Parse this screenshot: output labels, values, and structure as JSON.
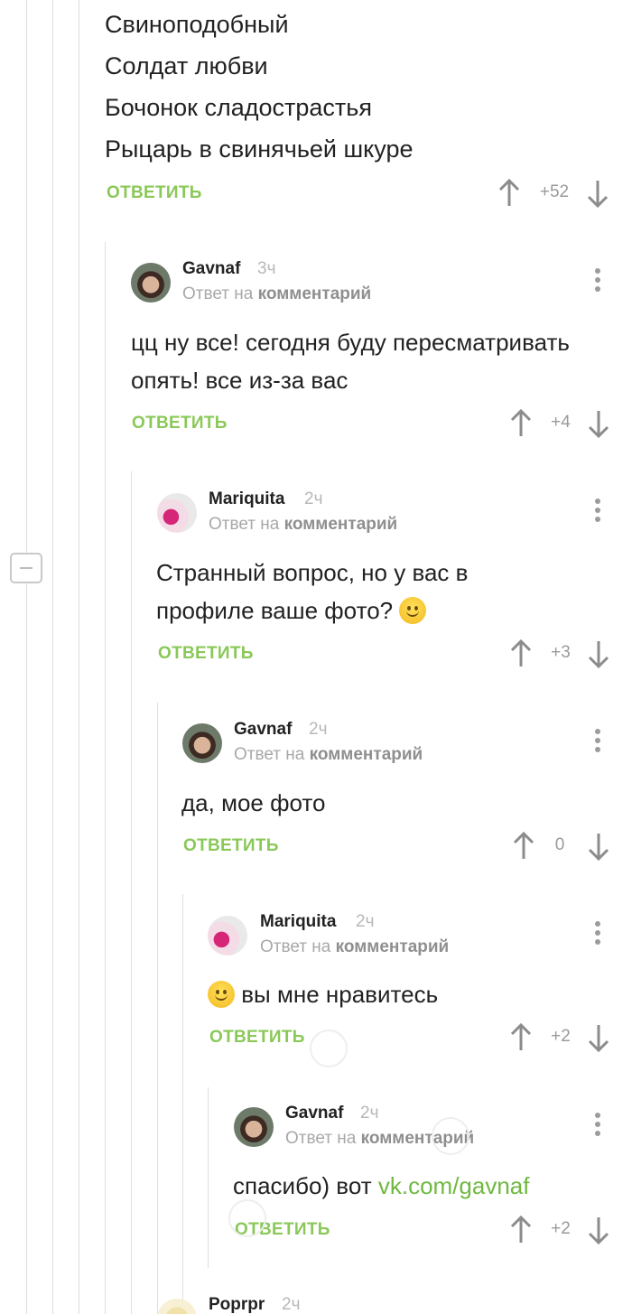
{
  "top_comment": {
    "lines": [
      "Свиноподобный",
      "Солдат любви",
      "Бочонок сладострастья",
      "Рыцарь в свинячьей шкуре"
    ],
    "reply_label": "ОТВЕТИТЬ",
    "score": "+52"
  },
  "comments": [
    {
      "author": "Gavnaf",
      "time": "3ч",
      "reply_prefix": "Ответ на",
      "reply_target": "комментарий",
      "text": "цц ну все! сегодня буду пересматривать опять! все из-за вас",
      "reply_label": "ОТВЕТИТЬ",
      "score": "+4"
    },
    {
      "author": "Mariquita",
      "time": "2ч",
      "reply_prefix": "Ответ на",
      "reply_target": "комментарий",
      "text": "Странный вопрос, но у вас в профиле ваше фото?",
      "reply_label": "ОТВЕТИТЬ",
      "score": "+3"
    },
    {
      "author": "Gavnaf",
      "time": "2ч",
      "reply_prefix": "Ответ на",
      "reply_target": "комментарий",
      "text": "да, мое фото",
      "reply_label": "ОТВЕТИТЬ",
      "score": "0"
    },
    {
      "author": "Mariquita",
      "time": "2ч",
      "reply_prefix": "Ответ на",
      "reply_target": "комментарий",
      "text": "вы мне нравитесь",
      "reply_label": "ОТВЕТИТЬ",
      "score": "+2"
    },
    {
      "author": "Gavnaf",
      "time": "2ч",
      "reply_prefix": "Ответ на",
      "reply_target": "комментарий",
      "text": "спасибо) вот",
      "link": "vk.com/gavnaf",
      "reply_label": "ОТВЕТИТЬ",
      "score": "+2"
    },
    {
      "author": "Poprpr",
      "time": "2ч"
    }
  ],
  "colors": {
    "accent": "#8ac858",
    "link": "#6fb940",
    "muted": "#a8a8a8"
  },
  "icons": {
    "upvote": "arrow-up-icon",
    "downvote": "arrow-down-icon",
    "menu": "kebab-menu-icon",
    "collapse": "minus-icon"
  }
}
